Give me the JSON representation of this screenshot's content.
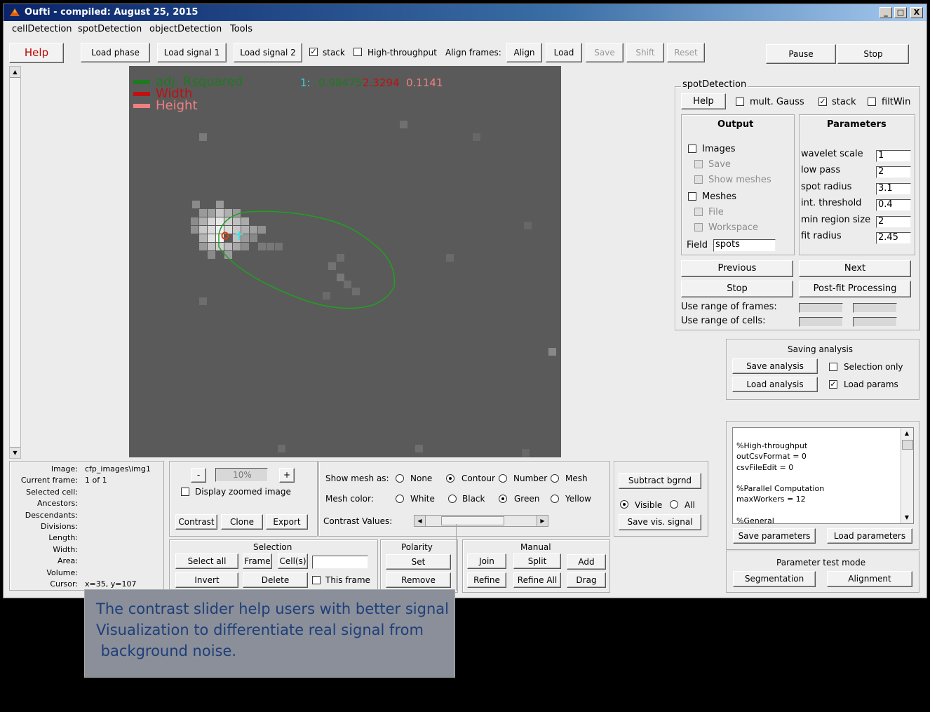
{
  "window": {
    "title": "Oufti - compiled:  August 25, 2015",
    "controls": [
      "_",
      "□",
      "X"
    ]
  },
  "menu": [
    "cellDetection",
    "spotDetection",
    "objectDetection",
    "Tools"
  ],
  "toolbar": {
    "help": "Help",
    "load_phase": "Load phase",
    "load_signal_1": "Load signal 1",
    "load_signal_2": "Load signal 2",
    "stack": "stack",
    "high_throughput": "High-throughput",
    "align_frames": "Align frames:",
    "align": "Align",
    "load": "Load",
    "save": "Save",
    "shift": "Shift",
    "reset": "Reset",
    "pause": "Pause",
    "stop": "Stop"
  },
  "image": {
    "legend": [
      "adj. Rsquared",
      "Width",
      "Height"
    ],
    "legend_colors": [
      "#1e7a1e",
      "#c01010",
      "#f08080"
    ],
    "readout_index": "1:",
    "readout_values": [
      "0.98475",
      "2.3294",
      "0.1141"
    ]
  },
  "spot": {
    "title": "spotDetection",
    "help": "Help",
    "mult_gauss": "mult. Gauss",
    "stack": "stack",
    "filtwin": "filtWin",
    "output_title": "Output",
    "images": "Images",
    "save": "Save",
    "show_meshes": "Show meshes",
    "meshes": "Meshes",
    "file": "File",
    "workspace": "Workspace",
    "field_label": "Field",
    "field_value": "spots",
    "params_title": "Parameters",
    "params": [
      {
        "label": "wavelet scale",
        "value": "1"
      },
      {
        "label": "low pass",
        "value": "2"
      },
      {
        "label": "spot radius",
        "value": "3.1"
      },
      {
        "label": "int. threshold",
        "value": "0.4"
      },
      {
        "label": "min region size",
        "value": "2"
      },
      {
        "label": "fit radius",
        "value": "2.45"
      }
    ],
    "previous": "Previous",
    "next": "Next",
    "stop": "Stop",
    "post_fit": "Post-fit Processing",
    "range_frames": "Use range of frames:",
    "range_cells": "Use range of cells:"
  },
  "saving": {
    "title": "Saving analysis",
    "save": "Save analysis",
    "load": "Load analysis",
    "selection_only": "Selection only",
    "load_params": "Load params"
  },
  "params_text": [
    "%High-throughput",
    "outCsvFormat = 0",
    "csvFileEdit = 0",
    "",
    "%Parallel Computation",
    "maxWorkers = 12",
    "",
    "%General"
  ],
  "params_buttons": {
    "save": "Save parameters",
    "load": "Load parameters"
  },
  "test_mode": {
    "title": "Parameter test mode",
    "segmentation": "Segmentation",
    "alignment": "Alignment"
  },
  "info": {
    "labels": [
      "Image:",
      "Current frame:",
      "Selected cell:",
      "Ancestors:",
      "Descendants:",
      "Divisions:",
      "Length:",
      "Width:",
      "Area:",
      "Volume:",
      "Cursor:"
    ],
    "values": [
      "cfp_images\\img1",
      "1 of 1",
      "",
      "",
      "",
      "",
      "",
      "",
      "",
      "",
      "x=35, y=107"
    ]
  },
  "zoom": {
    "minus": "-",
    "value": "10%",
    "plus": "+",
    "display_zoomed": "Display zoomed image",
    "contrast": "Contrast",
    "clone": "Clone",
    "export": "Export"
  },
  "mesh": {
    "show_as": "Show mesh as:",
    "options": [
      "None",
      "Contour",
      "Number",
      "Mesh"
    ],
    "selected_show": "Contour",
    "color_label": "Mesh color:",
    "colors": [
      "White",
      "Black",
      "Green",
      "Yellow"
    ],
    "selected_color": "Green",
    "contrast_label": "Contrast Values:",
    "contrast_level": 0.32
  },
  "bgrnd": {
    "subtract": "Subtract bgrnd",
    "visible": "Visible",
    "all": "All",
    "save_vis": "Save vis. signal"
  },
  "selection": {
    "title": "Selection",
    "select_all": "Select all",
    "frame": "Frame",
    "cells": "Cell(s)",
    "invert": "Invert",
    "delete": "Delete",
    "this_frame": "This frame"
  },
  "polarity": {
    "title": "Polarity",
    "set": "Set",
    "remove": "Remove"
  },
  "manual": {
    "title": "Manual",
    "join": "Join",
    "split": "Split",
    "add": "Add",
    "refine": "Refine",
    "refine_all": "Refine All",
    "drag": "Drag"
  },
  "note": [
    "The contrast slider help users  with better signal",
    "Visualization to differentiate real signal from",
    " background noise."
  ]
}
